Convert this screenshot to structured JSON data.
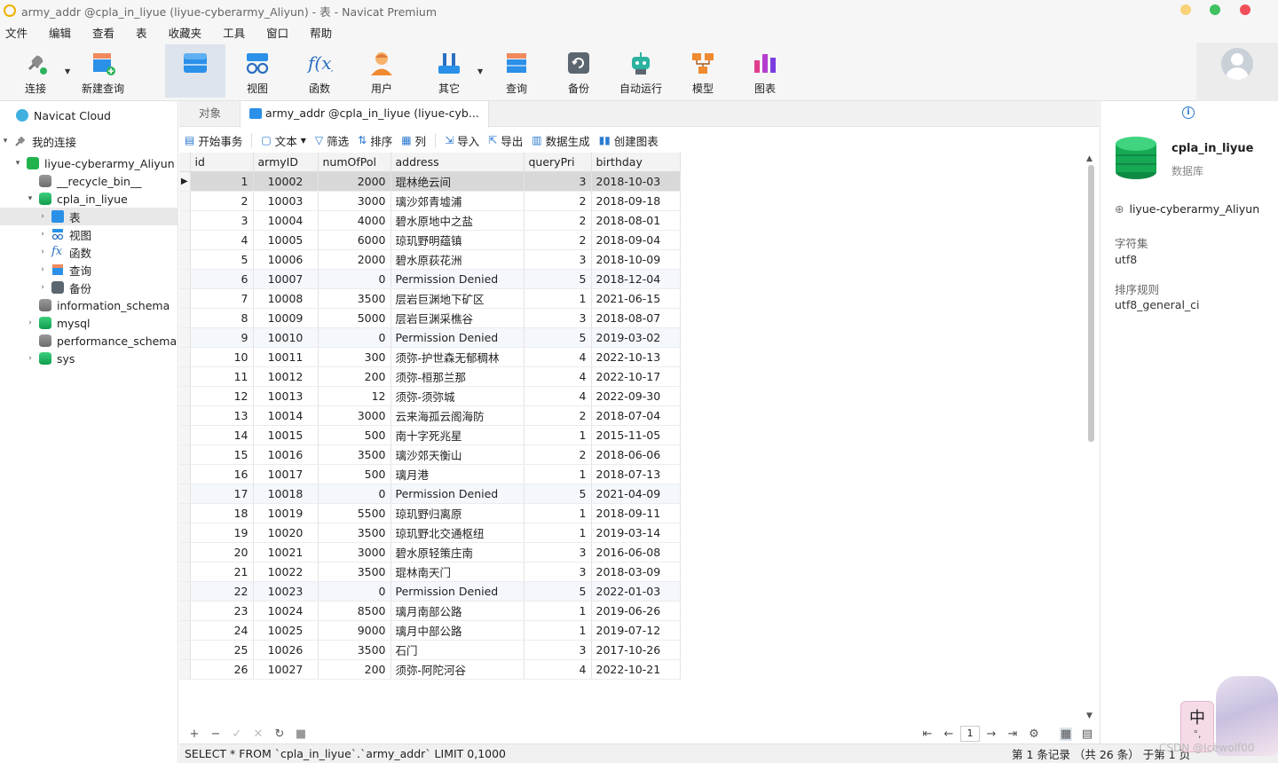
{
  "window": {
    "title": "army_addr @cpla_in_liyue (liyue-cyberarmy_Aliyun) - 表 - Navicat Premium",
    "controls": [
      "#f9d27a",
      "#3fc15f",
      "#f24e5a"
    ]
  },
  "menu": [
    "文件",
    "编辑",
    "查看",
    "表",
    "收藏夹",
    "工具",
    "窗口",
    "帮助"
  ],
  "toolbar": {
    "connect": "连接",
    "new_query": "新建查询",
    "table": "表",
    "view": "视图",
    "function": "函数",
    "user": "用户",
    "other": "其它",
    "query": "查询",
    "backup": "备份",
    "automation": "自动运行",
    "model": "模型",
    "chart": "图表"
  },
  "nav": {
    "cloud": "Navicat Cloud",
    "my_connections": "我的连接",
    "connection": "liyue-cyberarmy_Aliyun",
    "recycle": "__recycle_bin__",
    "db": "cpla_in_liyue",
    "tables": "表",
    "views": "视图",
    "functions": "函数",
    "queries": "查询",
    "backups": "备份",
    "information_schema": "information_schema",
    "mysql": "mysql",
    "performance_schema": "performance_schema",
    "sys": "sys"
  },
  "tabs": {
    "objects": "对象",
    "active": "army_addr @cpla_in_liyue (liyue-cyb..."
  },
  "table_tools": {
    "begin_tx": "开始事务",
    "text": "文本",
    "filter": "筛选",
    "sort": "排序",
    "columns": "列",
    "import": "导入",
    "export": "导出",
    "data_gen": "数据生成",
    "create_chart": "创建图表"
  },
  "grid": {
    "headers": [
      "id",
      "armyID",
      "numOfPol",
      "address",
      "queryPri",
      "birthday"
    ],
    "rows": [
      [
        "1",
        "10002",
        "2000",
        "琨林绝云间",
        "3",
        "2018-10-03"
      ],
      [
        "2",
        "10003",
        "3000",
        "璃沙郊青墟浦",
        "2",
        "2018-09-18"
      ],
      [
        "3",
        "10004",
        "4000",
        "碧水原地中之盐",
        "2",
        "2018-08-01"
      ],
      [
        "4",
        "10005",
        "6000",
        "琼玑野明蕴镇",
        "2",
        "2018-09-04"
      ],
      [
        "5",
        "10006",
        "2000",
        "碧水原荻花洲",
        "3",
        "2018-10-09"
      ],
      [
        "6",
        "10007",
        "0",
        "Permission Denied",
        "5",
        "2018-12-04"
      ],
      [
        "7",
        "10008",
        "3500",
        "层岩巨渊地下矿区",
        "1",
        "2021-06-15"
      ],
      [
        "8",
        "10009",
        "5000",
        "层岩巨渊采樵谷",
        "3",
        "2018-08-07"
      ],
      [
        "9",
        "10010",
        "0",
        "Permission Denied",
        "5",
        "2019-03-02"
      ],
      [
        "10",
        "10011",
        "300",
        "须弥-护世森无郁稠林",
        "4",
        "2022-10-13"
      ],
      [
        "11",
        "10012",
        "200",
        "须弥-桓那兰那",
        "4",
        "2022-10-17"
      ],
      [
        "12",
        "10013",
        "12",
        "须弥-须弥城",
        "4",
        "2022-09-30"
      ],
      [
        "13",
        "10014",
        "3000",
        "云来海孤云阁海防",
        "2",
        "2018-07-04"
      ],
      [
        "14",
        "10015",
        "500",
        "南十字死兆星",
        "1",
        "2015-11-05"
      ],
      [
        "15",
        "10016",
        "3500",
        "璃沙郊天衡山",
        "2",
        "2018-06-06"
      ],
      [
        "16",
        "10017",
        "500",
        "璃月港",
        "1",
        "2018-07-13"
      ],
      [
        "17",
        "10018",
        "0",
        "Permission Denied",
        "5",
        "2021-04-09"
      ],
      [
        "18",
        "10019",
        "5500",
        "琼玑野归离原",
        "1",
        "2018-09-11"
      ],
      [
        "19",
        "10020",
        "3500",
        "琼玑野北交通枢纽",
        "1",
        "2019-03-14"
      ],
      [
        "20",
        "10021",
        "3000",
        "碧水原轻策庄南",
        "3",
        "2016-06-08"
      ],
      [
        "21",
        "10022",
        "3500",
        "琨林南天门",
        "3",
        "2018-03-09"
      ],
      [
        "22",
        "10023",
        "0",
        "Permission Denied",
        "5",
        "2022-01-03"
      ],
      [
        "23",
        "10024",
        "8500",
        "璃月南部公路",
        "1",
        "2019-06-26"
      ],
      [
        "24",
        "10025",
        "9000",
        "璃月中部公路",
        "1",
        "2019-07-12"
      ],
      [
        "25",
        "10026",
        "3500",
        "石门",
        "3",
        "2017-10-26"
      ],
      [
        "26",
        "10027",
        "200",
        "须弥-阿陀河谷",
        "4",
        "2022-10-21"
      ]
    ]
  },
  "pager": {
    "page": "1"
  },
  "status": {
    "sql": "SELECT * FROM `cpla_in_liyue`.`army_addr` LIMIT 0,1000",
    "count": "第 1 条记录 （共 26 条） 于第 1 页"
  },
  "info": {
    "db_name": "cpla_in_liyue",
    "db_type": "数据库",
    "connection": "liyue-cyberarmy_Aliyun",
    "charset_label": "字符集",
    "charset": "utf8",
    "collation_label": "排序规则",
    "collation": "utf8_general_ci"
  },
  "ime": {
    "lang": "中",
    "punct": "°,"
  },
  "watermark": "CSDN @Icewolf00"
}
